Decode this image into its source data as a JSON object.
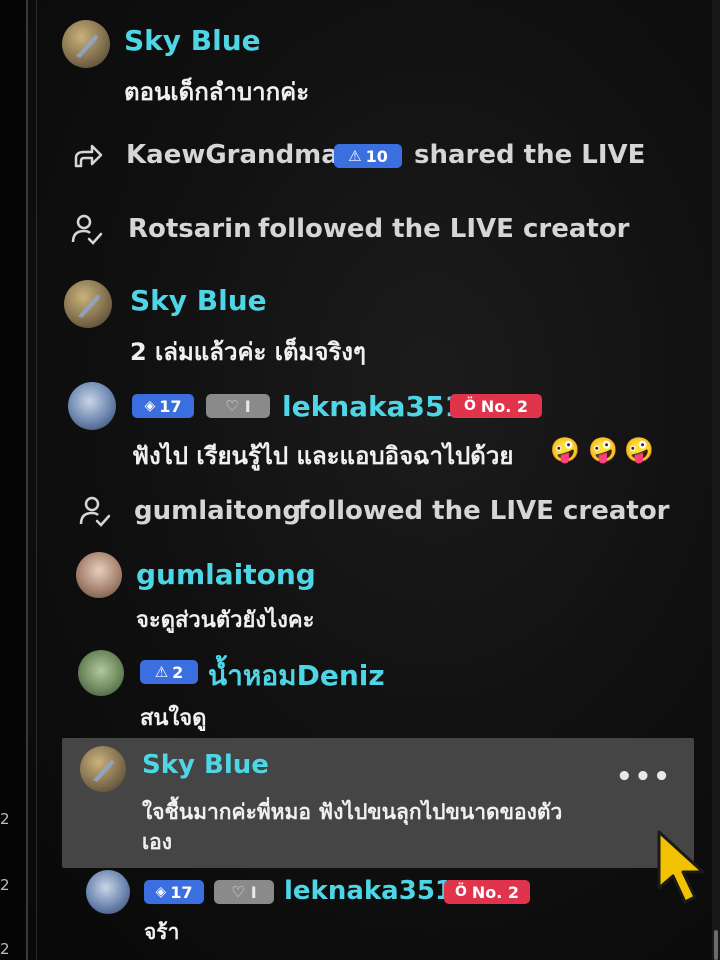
{
  "gutter": {
    "numbers": [
      "2",
      "2",
      "2"
    ]
  },
  "comments": [
    {
      "username": "Sky Blue",
      "message": "ตอนเด็กลำบากค่ะ"
    },
    {
      "username": "Sky Blue",
      "message": "2 เล่มแล้วค่ะ เต็มจริงๆ"
    },
    {
      "username": "leknaka351",
      "level": "17",
      "fan_level": "I",
      "rank": "No. 2",
      "message": "ฟังไป เรียนรู้ไป และแอบอิจฉาไปด้วย"
    },
    {
      "username": "gumlaitong",
      "message": "จะดูส่วนตัวยังไงคะ"
    },
    {
      "username": "น้ำหอมDeniz",
      "level": "2",
      "message": "สนใจดู"
    },
    {
      "username": "Sky Blue",
      "message_line1": "ใจชื้นมากค่ะพี่หมอ ฟังไปขนลุกไปขนาดของตัว",
      "message_line2": "เอง",
      "more": "•••"
    },
    {
      "username": "leknaka351",
      "level": "17",
      "fan_level": "I",
      "rank": "No. 2",
      "message": "จร้า"
    }
  ],
  "system_events": [
    {
      "type": "share",
      "icon": "share-icon",
      "username": "KaewGrandma",
      "level": "10",
      "text": "shared the LIVE"
    },
    {
      "type": "follow",
      "icon": "follow-icon",
      "username": "Rotsarin",
      "text": "followed the LIVE creator"
    },
    {
      "type": "follow",
      "icon": "follow-icon",
      "username": "gumlaitong",
      "text": "followed the LIVE creator"
    }
  ],
  "colors": {
    "username": "#4fd6e6",
    "badge_blue": "#3b6fe0",
    "badge_red": "#e0344d",
    "highlight": "#454545"
  }
}
